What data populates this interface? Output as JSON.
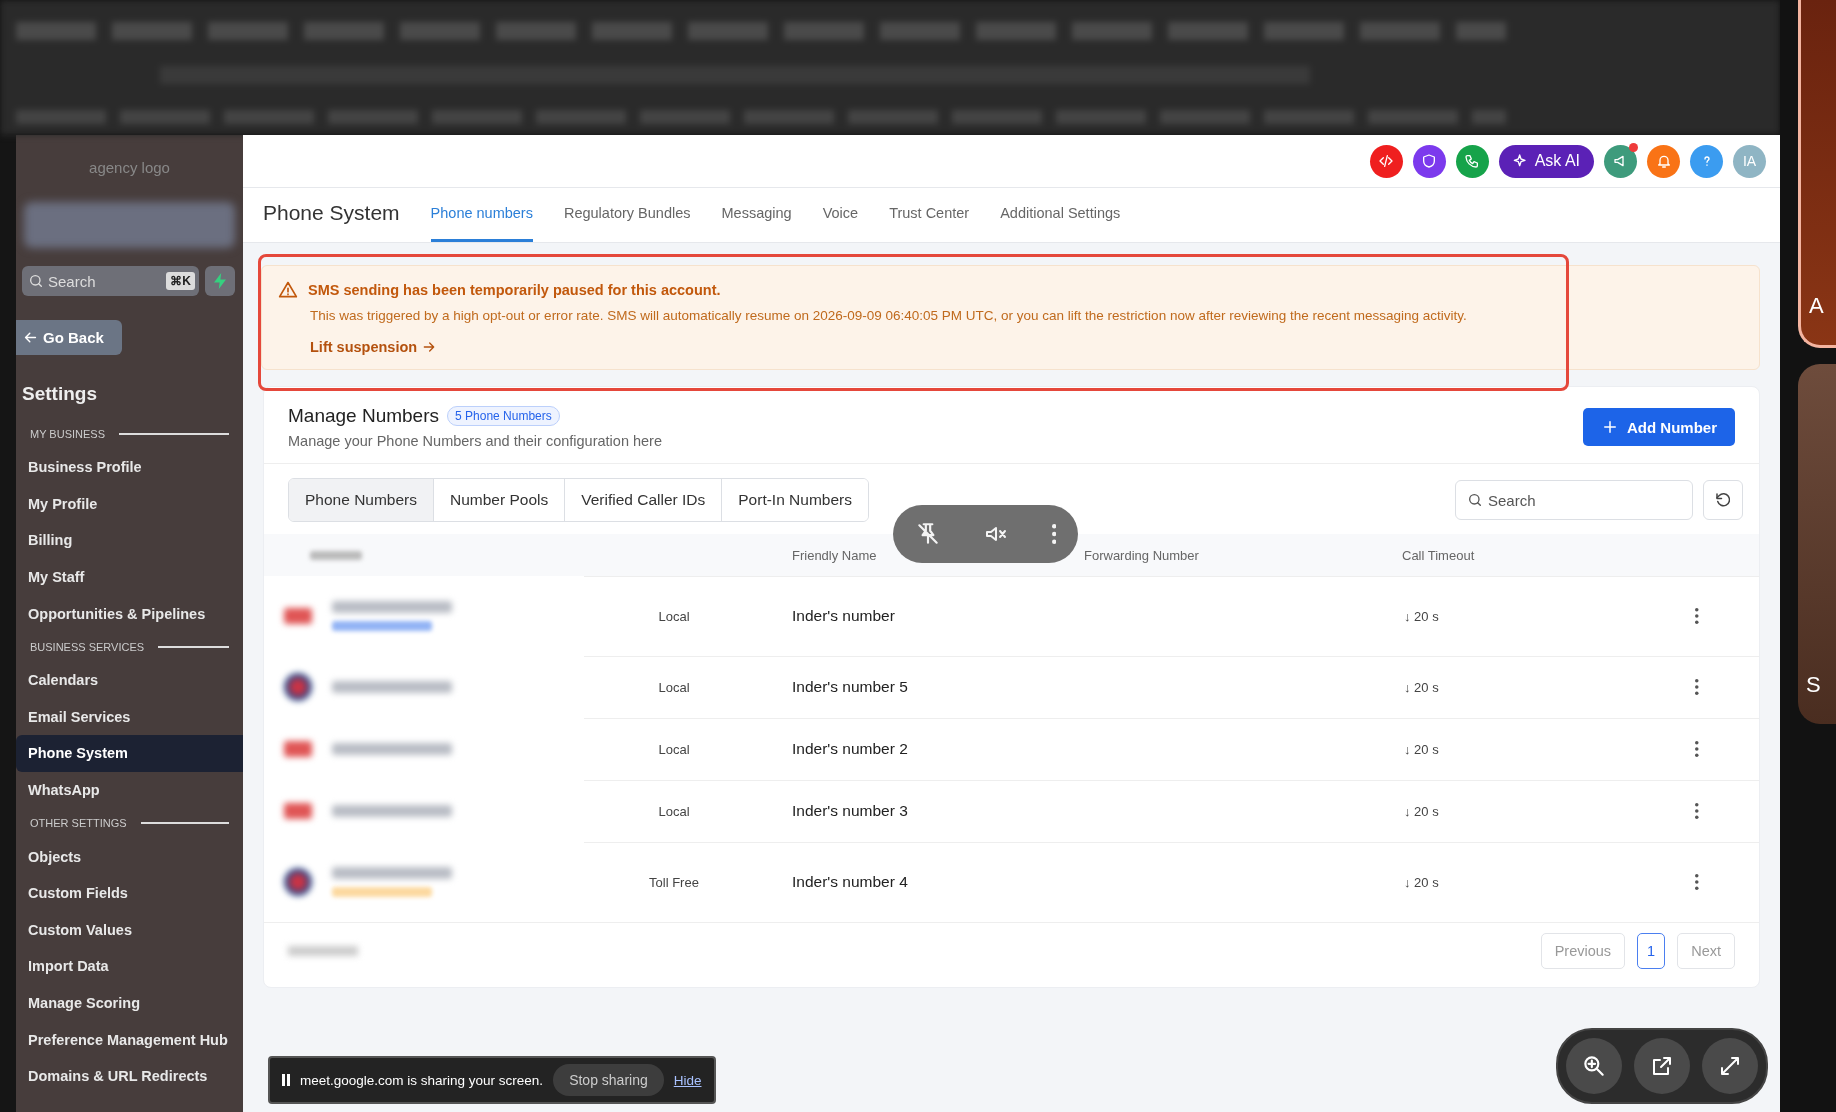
{
  "sidebar": {
    "logo_alt": "agency logo",
    "search": {
      "placeholder": "Search",
      "shortcut": "⌘K"
    },
    "back": "Go Back",
    "heading": "Settings",
    "sections": [
      {
        "title": "MY BUSINESS",
        "items": [
          {
            "label": "Business Profile",
            "selected": false
          },
          {
            "label": "My Profile",
            "selected": false
          },
          {
            "label": "Billing",
            "selected": false
          },
          {
            "label": "My Staff",
            "selected": false
          },
          {
            "label": "Opportunities & Pipelines",
            "selected": false
          }
        ]
      },
      {
        "title": "BUSINESS SERVICES",
        "items": [
          {
            "label": "Calendars",
            "selected": false
          },
          {
            "label": "Email Services",
            "selected": false
          },
          {
            "label": "Phone System",
            "selected": true
          },
          {
            "label": "WhatsApp",
            "selected": false
          }
        ]
      },
      {
        "title": "OTHER SETTINGS",
        "items": [
          {
            "label": "Objects",
            "selected": false
          },
          {
            "label": "Custom Fields",
            "selected": false
          },
          {
            "label": "Custom Values",
            "selected": false
          },
          {
            "label": "Import Data",
            "selected": false
          },
          {
            "label": "Manage Scoring",
            "selected": false
          },
          {
            "label": "Preference Management Hub",
            "selected": false
          },
          {
            "label": "Domains & URL Redirects",
            "selected": false
          }
        ]
      }
    ]
  },
  "header": {
    "ask_ai": "Ask AI",
    "avatar": "IA",
    "notification_dot": true
  },
  "page": {
    "title": "Phone System",
    "tabs": [
      {
        "label": "Phone numbers",
        "selected": true
      },
      {
        "label": "Regulatory Bundles",
        "selected": false
      },
      {
        "label": "Messaging",
        "selected": false
      },
      {
        "label": "Voice",
        "selected": false
      },
      {
        "label": "Trust Center",
        "selected": false
      },
      {
        "label": "Additional Settings",
        "selected": false
      }
    ]
  },
  "alert": {
    "title": "SMS sending has been temporarily paused for this account.",
    "message": "This was triggered by a high opt-out or error rate. SMS will automatically resume on 2026-09-09 06:40:05 PM UTC, or you can lift the restriction now after reviewing the recent messaging activity.",
    "link": "Lift suspension"
  },
  "card": {
    "title": "Manage Numbers",
    "badge": "5 Phone Numbers",
    "subtitle": "Manage your Phone Numbers and their configuration here",
    "add_button": "Add Number",
    "subtabs": [
      {
        "label": "Phone Numbers",
        "selected": true
      },
      {
        "label": "Number Pools",
        "selected": false
      },
      {
        "label": "Verified Caller IDs",
        "selected": false
      },
      {
        "label": "Port-In Numbers",
        "selected": false
      }
    ],
    "search": {
      "placeholder": "Search"
    },
    "columns": {
      "friendly_name": "Friendly Name",
      "forwarding": "Forwarding Number",
      "timeout": "Call Timeout"
    },
    "rows": [
      {
        "kind": "other",
        "type": "Local",
        "name": "Inder's number",
        "timeout": "↓ 20 s",
        "tag": {
          "color": "#93b4f5"
        }
      },
      {
        "kind": "us",
        "type": "Local",
        "name": "Inder's number 5",
        "timeout": "↓ 20 s"
      },
      {
        "kind": "other",
        "type": "Local",
        "name": "Inder's number 2",
        "timeout": "↓ 20 s"
      },
      {
        "kind": "other",
        "type": "Local",
        "name": "Inder's number 3",
        "timeout": "↓ 20 s"
      },
      {
        "kind": "us",
        "type": "Toll Free",
        "name": "Inder's number 4",
        "timeout": "↓ 20 s",
        "tag": {
          "color": "#fcd9a0"
        }
      }
    ],
    "pagination": {
      "previous": "Previous",
      "page": "1",
      "next": "Next"
    }
  },
  "screen_share": {
    "text": "meet.google.com is sharing your screen.",
    "stop": "Stop sharing",
    "hide": "Hide"
  },
  "tiles": [
    {
      "letter": "A",
      "speaking": true
    },
    {
      "letter": "S",
      "speaking": false
    }
  ]
}
